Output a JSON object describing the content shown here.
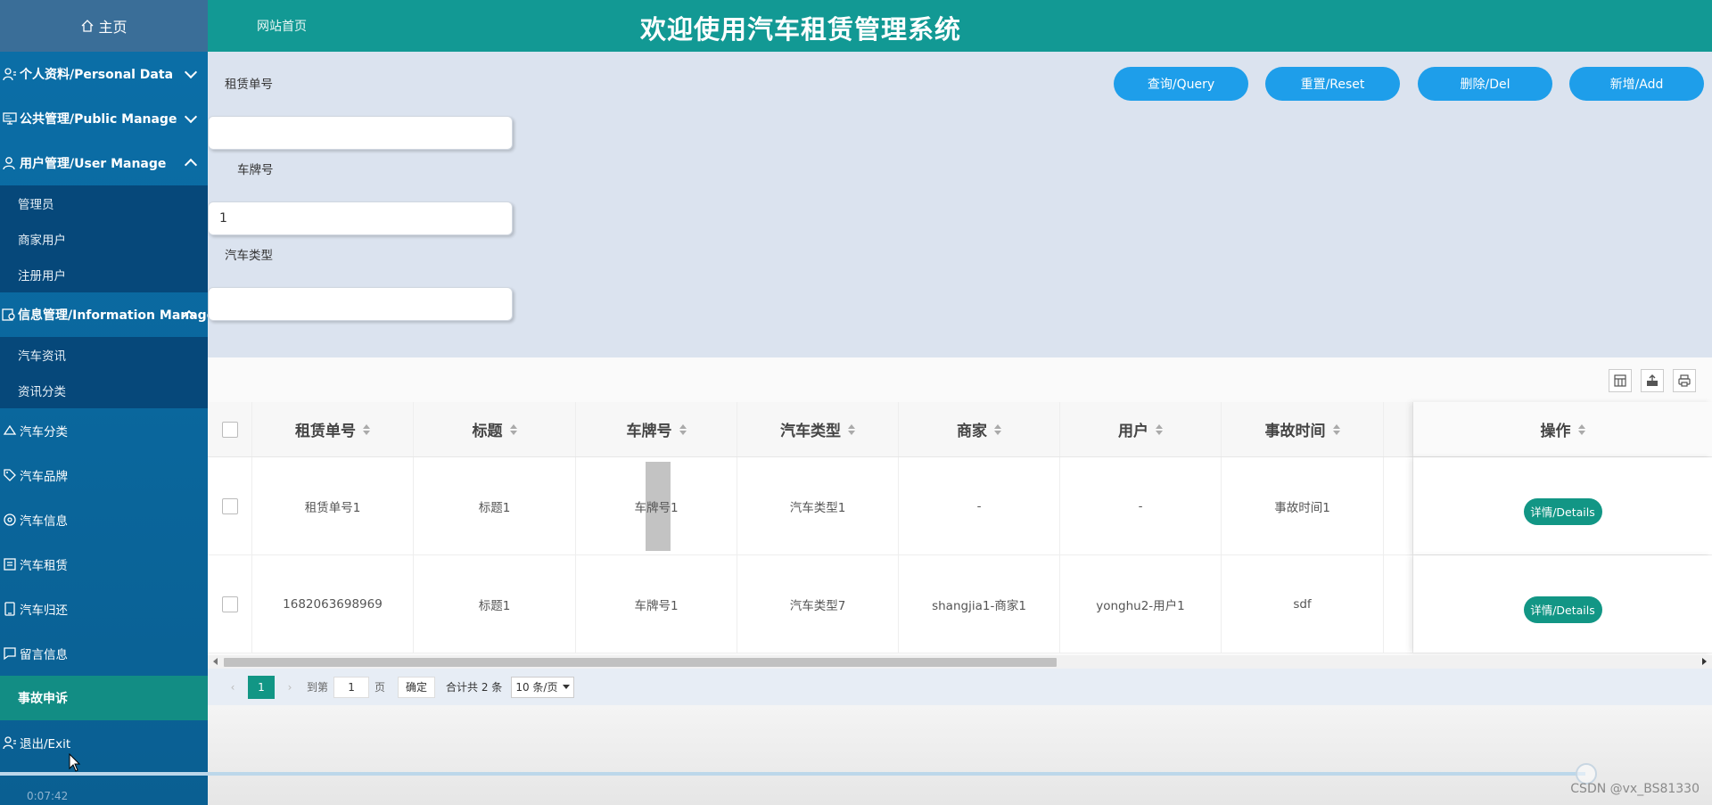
{
  "sidebar": {
    "home": "主页",
    "menus": [
      {
        "label": "个人资料/Personal Data",
        "icon": "person-icon",
        "expanded": false
      },
      {
        "label": "公共管理/Public Manage",
        "icon": "monitor-icon",
        "expanded": false
      },
      {
        "label": "用户管理/User Manage",
        "icon": "user-icon",
        "expanded": true,
        "items": [
          "管理员",
          "商家用户",
          "注册用户"
        ]
      },
      {
        "label": "信息管理/Information Manage",
        "icon": "gear-doc-icon",
        "expanded": true,
        "items": [
          "汽车资讯",
          "资讯分类"
        ]
      }
    ],
    "singles": [
      "汽车分类",
      "汽车品牌",
      "汽车信息",
      "汽车租赁",
      "汽车归还",
      "留言信息"
    ],
    "active": "事故申诉",
    "logout": "退出/Exit"
  },
  "topbar": {
    "home_link": "网站首页",
    "title": "欢迎使用汽车租赁管理系统"
  },
  "search": {
    "fields": [
      {
        "label": "租赁单号",
        "value": ""
      },
      {
        "label": "车牌号",
        "value": "1"
      },
      {
        "label": "汽车类型",
        "value": ""
      }
    ],
    "buttons": {
      "query": "查询/Query",
      "reset": "重置/Reset",
      "delete": "删除/Del",
      "add": "新增/Add"
    }
  },
  "table": {
    "columns": [
      "租赁单号",
      "标题",
      "车牌号",
      "汽车类型",
      "商家",
      "用户",
      "事故时间",
      "操作"
    ],
    "rows": [
      [
        "租赁单号1",
        "标题1",
        "车牌号1",
        "汽车类型1",
        "-",
        "-",
        "事故时间1"
      ],
      [
        "1682063698969",
        "标题1",
        "车牌号1",
        "汽车类型7",
        "shangjia1-商家1",
        "yonghu2-用户1",
        "sdf"
      ]
    ],
    "details_label": "详情/Details"
  },
  "pager": {
    "current_page": "1",
    "goto_label": "到第",
    "goto_value": "1",
    "page_unit": "页",
    "confirm": "确定",
    "total": "合计共 2 条",
    "page_size": "10 条/页"
  },
  "overlay": {
    "time": "0:07:42",
    "watermark": "CSDN @vx_BS81330"
  }
}
